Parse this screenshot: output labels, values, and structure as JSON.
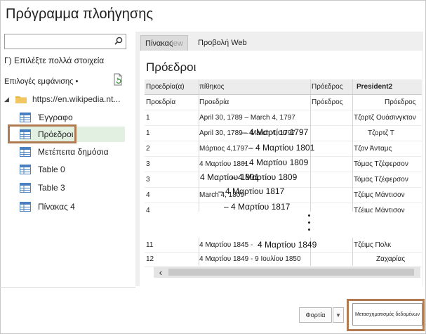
{
  "window": {
    "title": "Πρόγραμμα πλοήγησης"
  },
  "left": {
    "search_placeholder": "",
    "multi_select_label": "Γ) Επιλέξτε πολλά στοιχεία",
    "display_options_label": "Επιλογές εμφάνισης",
    "display_options_caret": "•",
    "tree_root_label": "https://en.wikipedia.nt...",
    "tree_root_caret": "◢",
    "nodes": [
      {
        "label": "Έγγραφο"
      },
      {
        "label": "Πρόεδροι"
      },
      {
        "label": "Μετέπειτα δημόσια"
      },
      {
        "label": "Table 0"
      },
      {
        "label": "Table 3"
      },
      {
        "label": "Πίνακας 4"
      }
    ]
  },
  "tabs": {
    "table": "Πίνακας",
    "table_ghost": "iew",
    "web": "Προβολή Web"
  },
  "preview": {
    "title": "Πρόεδροι",
    "headers": [
      "Προεδρία(α)",
      "πίθηκος",
      "Πρόεδρος",
      "President2"
    ],
    "subheaders": [
      "Προεδρία",
      "Προεδρία",
      "Πρόεδρος",
      "Πρόεδρος"
    ],
    "rows": [
      [
        "1",
        "April 30, 1789 – March 4, 1797",
        "",
        "Τζορτζ Ουάσινγκτον"
      ],
      [
        "1",
        "April 30, 1789 – March 4, 1797",
        "",
        "Τζορτζ Τ"
      ],
      [
        "2",
        "Μάρτιος 4,1797 -",
        "",
        "Τζον Άνταμς"
      ],
      [
        "3",
        "4 Μαρτίου 1801",
        "",
        "Τόμας Τζέφερσον"
      ],
      [
        "3",
        "",
        "",
        "Τόμας Τζέφερσον"
      ],
      [
        "4",
        "March 4, 1809",
        "",
        "Τζέιμς Μάντισον"
      ],
      [
        "4",
        "",
        "",
        "Τζέιμς Μάντισον"
      ]
    ],
    "overlays": [
      "– 4 Μαρτίου 1797",
      "– 4 Μαρτίου 1801",
      "– 4 Μαρτίου 1809",
      "4 Μαρτίου 1801",
      "– 4 Μαρτίου 1809",
      "– 4 Μαρτίου 1817",
      "– 4 Μαρτίου 1817"
    ],
    "rows_bottom": [
      [
        "11",
        "4 Μαρτίου 1845 -",
        "",
        "Τζέιμς Πολκ"
      ],
      [
        "12",
        "4 Μαρτίου 1849 - 9 Ιουλίου 1850",
        "",
        "Ζαχαρίας"
      ]
    ],
    "overlays_bottom": [
      "4 Μαρτίου 1849"
    ],
    "scroll_left": "‹"
  },
  "buttons": {
    "load": "Φορτία",
    "load_arrow": "▼",
    "transform": "Μετασχηματισμός δεδομένων"
  },
  "colors": {
    "highlight_outline": "#b07a52",
    "selected_bg": "#e2f0e2",
    "table_icon": "#4a7fc0"
  }
}
